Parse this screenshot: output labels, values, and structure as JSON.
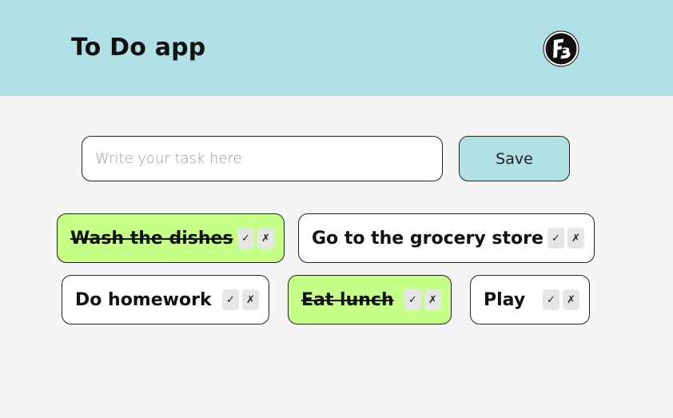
{
  "header": {
    "title": "To Do app"
  },
  "form": {
    "placeholder": "Write your task here",
    "value": "",
    "save_label": "Save"
  },
  "actions": {
    "complete_glyph": "✓",
    "delete_glyph": "✗"
  },
  "tasks": [
    {
      "text": "Wash the dishes",
      "completed": true
    },
    {
      "text": "Go to the grocery store",
      "completed": false
    },
    {
      "text": "Do homework",
      "completed": false
    },
    {
      "text": "Eat lunch",
      "completed": true
    },
    {
      "text": "Play",
      "completed": false
    }
  ],
  "colors": {
    "header_bg": "#b0dfe5",
    "completed_task_bg": "#c4ff88",
    "page_bg": "#f5f5f5"
  },
  "icons": {
    "logo": "fb-logo-icon"
  }
}
